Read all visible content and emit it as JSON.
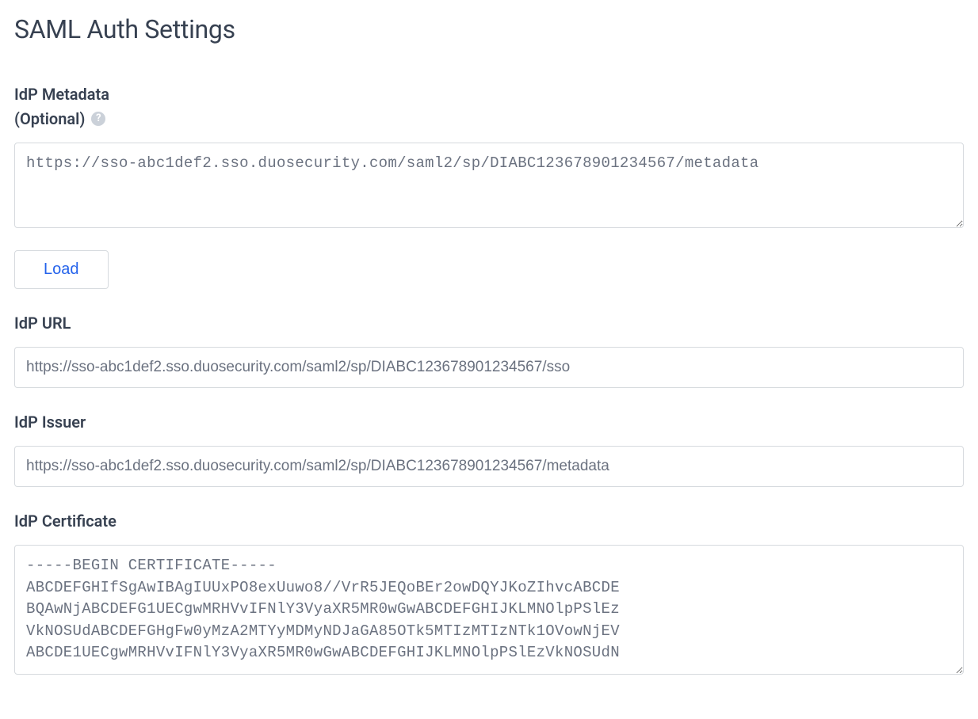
{
  "page": {
    "title": "SAML Auth Settings"
  },
  "fields": {
    "idp_metadata": {
      "label_line1": "IdP Metadata",
      "label_optional": "(Optional)",
      "value": "https://sso-abc1def2.sso.duosecurity.com/saml2/sp/DIABC123678901234567/metadata"
    },
    "load_button": {
      "label": "Load"
    },
    "idp_url": {
      "label": "IdP URL",
      "value": "https://sso-abc1def2.sso.duosecurity.com/saml2/sp/DIABC123678901234567/sso"
    },
    "idp_issuer": {
      "label": "IdP Issuer",
      "value": "https://sso-abc1def2.sso.duosecurity.com/saml2/sp/DIABC123678901234567/metadata"
    },
    "idp_certificate": {
      "label": "IdP Certificate",
      "value": "-----BEGIN CERTIFICATE-----\nABCDEFGHIfSgAwIBAgIUUxPO8exUuwo8//VrR5JEQoBEr2owDQYJKoZIhvcABCDE\nBQAwNjABCDEFG1UECgwMRHVvIFNlY3VyaXR5MR0wGwABCDEFGHIJKLMNOlpPSlEz\nVkNOSUdABCDEFGHgFw0yMzA2MTYyMDMyNDJaGA85OTk5MTIzMTIzNTk1OVowNjEV\nABCDE1UECgwMRHVvIFNlY3VyaXR5MR0wGwABCDEFGHIJKLMNOlpPSlEzVkNOSUdN"
    }
  },
  "icons": {
    "help_glyph": "?"
  }
}
